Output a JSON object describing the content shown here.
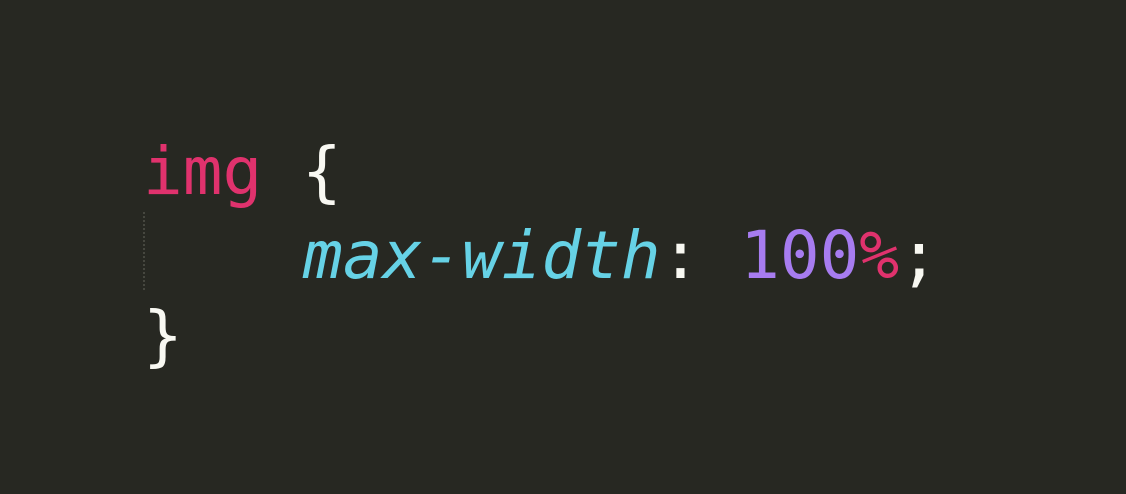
{
  "code": {
    "selector": "img",
    "open_brace": "{",
    "property": "max-width",
    "colon": ":",
    "value_number": "100",
    "value_unit": "%",
    "semicolon": ";",
    "close_brace": "}"
  },
  "colors": {
    "background": "#272822",
    "selector": "#e0326d",
    "punctuation": "#f8f8f2",
    "property": "#66d2e6",
    "number": "#a77cf0",
    "unit": "#e0326d"
  }
}
